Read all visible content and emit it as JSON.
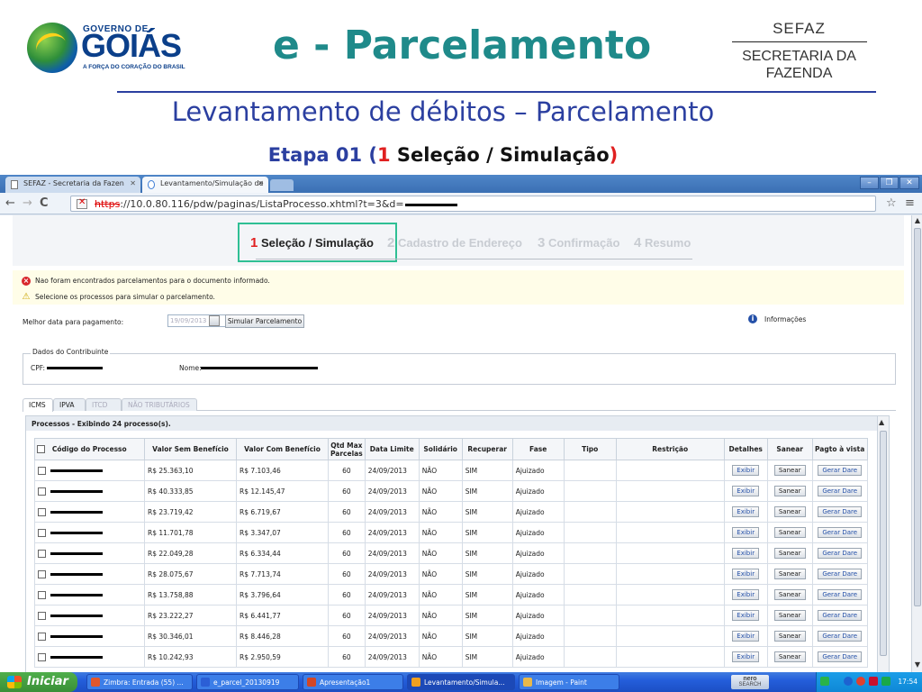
{
  "slide": {
    "logo": {
      "line1": "GOVERNO DE",
      "line2": "GOIÁS",
      "tagline": "A FORÇA DO CORAÇÃO DO BRASIL"
    },
    "title": "e - Parcelamento",
    "org_abbr": "SEFAZ",
    "org_name_line1": "SECRETARIA DA",
    "org_name_line2": "FAZENDA",
    "subtitle": "Levantamento de débitos – Parcelamento",
    "step": {
      "prefix": "Etapa 01 (",
      "num": "1",
      "label": " Seleção / Simulação",
      "suffix": ")"
    }
  },
  "browser": {
    "tabs": [
      {
        "label": "SEFAZ - Secretaria da Fazen"
      },
      {
        "label": "Levantamento/Simulação de"
      }
    ],
    "url": {
      "scheme": "https",
      "rest": "://10.0.80.116/pdw/paginas/ListaProcesso.xhtml?t=3&d="
    }
  },
  "wizard": {
    "steps": [
      {
        "num": "1",
        "label": "Seleção / Simulação"
      },
      {
        "num": "2",
        "label": "Cadastro de Endereço"
      },
      {
        "num": "3",
        "label": "Confirmação"
      },
      {
        "num": "4",
        "label": "Resumo"
      }
    ]
  },
  "messages": {
    "error": "Nao foram encontrados parcelamentos para o documento informado.",
    "warning": "Selecione os processos para simular o parcelamento."
  },
  "form": {
    "date_label": "Melhor data para pagamento:",
    "date_value": "19/09/2013",
    "simulate_button": "Simular Parcelamento",
    "info_label": "Informações"
  },
  "contribuinte": {
    "legend": "Dados do Contribuinte",
    "cpf_label": "CPF:",
    "nome_label": "Nome:"
  },
  "process_tabs": [
    "ICMS",
    "IPVA",
    "ITCD",
    "NÃO TRIBUTÁRIOS"
  ],
  "processes": {
    "header": "Processos - Exibindo 24 processo(s).",
    "columns": [
      "Código do Processo",
      "Valor Sem Benefício",
      "Valor Com Benefício",
      "Qtd Max Parcelas",
      "Data Limite",
      "Solidário",
      "Recuperar",
      "Fase",
      "Tipo",
      "Restrição",
      "Detalhes",
      "Sanear",
      "Pagto à vista"
    ],
    "action_labels": {
      "detalhes": "Exibir",
      "sanear": "Sanear",
      "pagto": "Gerar Dare"
    },
    "rows": [
      {
        "sem": "R$ 25.363,10",
        "com": "R$ 7.103,46",
        "qtd": "60",
        "data": "24/09/2013",
        "solidario": "NÃO",
        "recuperar": "SIM",
        "fase": "Ajuizado"
      },
      {
        "sem": "R$ 40.333,85",
        "com": "R$ 12.145,47",
        "qtd": "60",
        "data": "24/09/2013",
        "solidario": "NÃO",
        "recuperar": "SIM",
        "fase": "Ajuizado"
      },
      {
        "sem": "R$ 23.719,42",
        "com": "R$ 6.719,67",
        "qtd": "60",
        "data": "24/09/2013",
        "solidario": "NÃO",
        "recuperar": "SIM",
        "fase": "Ajuizado"
      },
      {
        "sem": "R$ 11.701,78",
        "com": "R$ 3.347,07",
        "qtd": "60",
        "data": "24/09/2013",
        "solidario": "NÃO",
        "recuperar": "SIM",
        "fase": "Ajuizado"
      },
      {
        "sem": "R$ 22.049,28",
        "com": "R$ 6.334,44",
        "qtd": "60",
        "data": "24/09/2013",
        "solidario": "NÃO",
        "recuperar": "SIM",
        "fase": "Ajuizado"
      },
      {
        "sem": "R$ 28.075,67",
        "com": "R$ 7.713,74",
        "qtd": "60",
        "data": "24/09/2013",
        "solidario": "NÃO",
        "recuperar": "SIM",
        "fase": "Ajuizado"
      },
      {
        "sem": "R$ 13.758,88",
        "com": "R$ 3.796,64",
        "qtd": "60",
        "data": "24/09/2013",
        "solidario": "NÃO",
        "recuperar": "SIM",
        "fase": "Ajuizado"
      },
      {
        "sem": "R$ 23.222,27",
        "com": "R$ 6.441,77",
        "qtd": "60",
        "data": "24/09/2013",
        "solidario": "NÃO",
        "recuperar": "SIM",
        "fase": "Ajuizado"
      },
      {
        "sem": "R$ 30.346,01",
        "com": "R$ 8.446,28",
        "qtd": "60",
        "data": "24/09/2013",
        "solidario": "NÃO",
        "recuperar": "SIM",
        "fase": "Ajuizado"
      },
      {
        "sem": "R$ 10.242,93",
        "com": "R$ 2.950,59",
        "qtd": "60",
        "data": "24/09/2013",
        "solidario": "NÃO",
        "recuperar": "SIM",
        "fase": "Ajuizado"
      }
    ]
  },
  "taskbar": {
    "start": "Iniciar",
    "items": [
      {
        "label": "Zimbra: Entrada (55) ...",
        "icon_color": "#e2572b"
      },
      {
        "label": "e_parcel_20130919",
        "icon_color": "#2b5fd6"
      },
      {
        "label": "Apresentação1",
        "icon_color": "#d24726"
      },
      {
        "label": "Levantamento/Simula...",
        "icon_color": "#f0a020"
      },
      {
        "label": "Imagem - Paint",
        "icon_color": "#e8b84a"
      }
    ],
    "nero_line1": "nero",
    "nero_line2": "SEARCH",
    "clock": "17:54"
  }
}
